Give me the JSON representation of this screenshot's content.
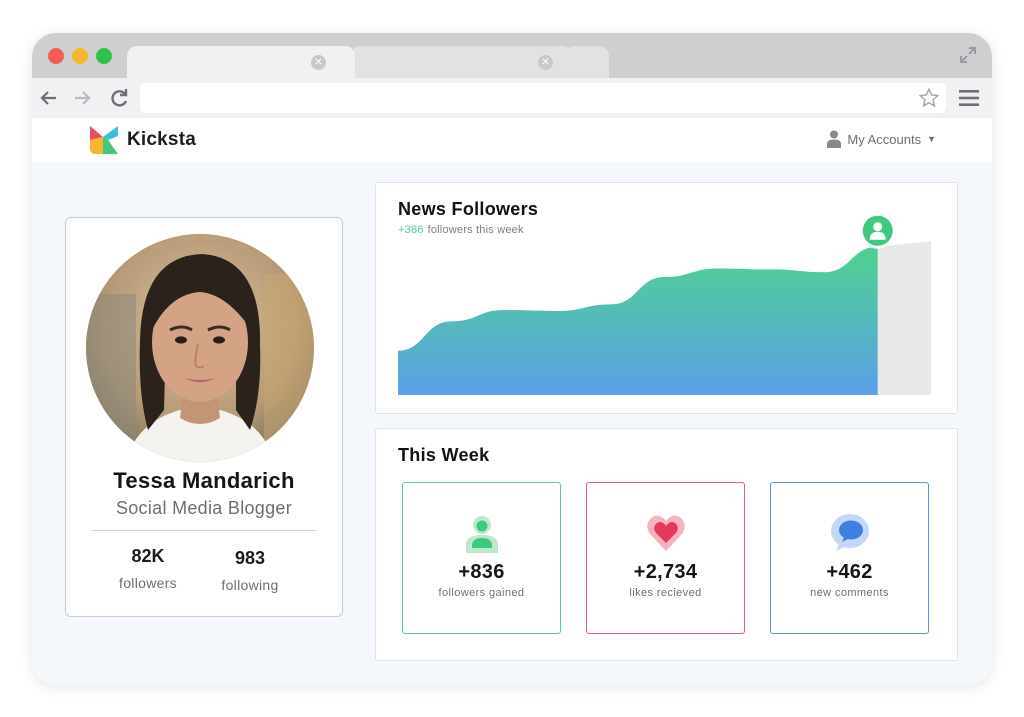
{
  "browser": {
    "tabs": [
      {
        "label": "",
        "active": true
      },
      {
        "label": "",
        "active": false
      }
    ],
    "url": ""
  },
  "header": {
    "logo_text": "Kicksta",
    "accounts_label": "My Accounts"
  },
  "profile": {
    "name": "Tessa Mandarich",
    "role": "Social Media Blogger",
    "stats": [
      {
        "value": "82K",
        "label": "followers"
      },
      {
        "value": "983",
        "label": "following"
      }
    ]
  },
  "followers_chart": {
    "title": "News Followers",
    "delta": "+386",
    "subtitle": "followers this week"
  },
  "chart_data": {
    "type": "area",
    "title": "News Followers",
    "note": "+386 followers this week",
    "x": [
      0,
      1,
      2,
      3,
      4,
      5,
      6,
      7,
      8,
      9,
      10
    ],
    "y": [
      47,
      78,
      90,
      89,
      96,
      125,
      134,
      133,
      130,
      157,
      163
    ],
    "current_index": 9,
    "ylim": [
      0,
      180
    ],
    "grid": false,
    "colors": {
      "gradient_top": "#4fd28f",
      "gradient_bottom": "#5aa0e8",
      "future": "#e8e8e8",
      "marker": "#3fc97f"
    }
  },
  "this_week": {
    "title": "This Week",
    "metrics": [
      {
        "value": "+836",
        "label": "followers gained",
        "icon": "user-icon",
        "color": "#55d08d"
      },
      {
        "value": "+2,734",
        "label": "likes recieved",
        "icon": "heart-icon",
        "color": "#e85a75"
      },
      {
        "value": "+462",
        "label": "new comments",
        "icon": "comment-icon",
        "color": "#5a8fe6"
      }
    ]
  }
}
